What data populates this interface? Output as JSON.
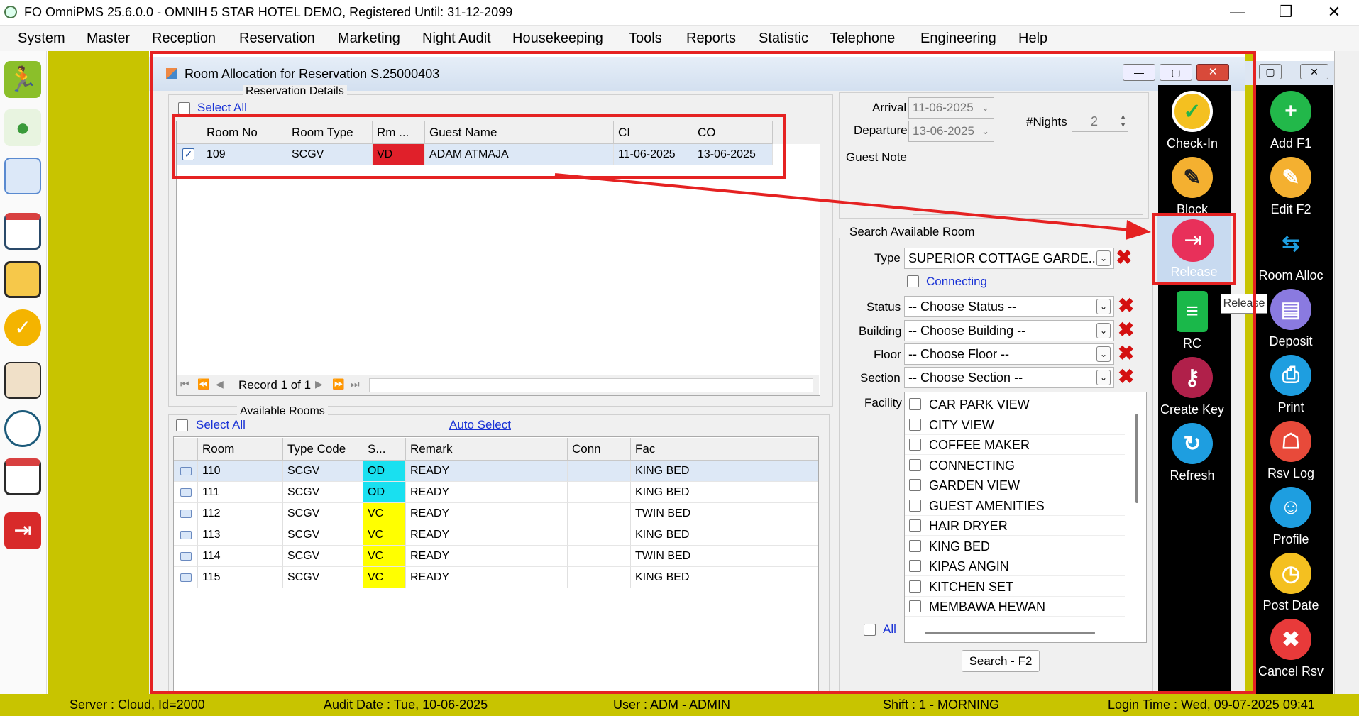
{
  "app": {
    "title": "FO OmniPMS 25.6.0.0 - OMNIH 5 STAR HOTEL DEMO, Registered Until: 31-12-2099"
  },
  "menu": [
    "System",
    "Master",
    "Reception",
    "Reservation",
    "Marketing",
    "Night Audit",
    "Housekeeping",
    "Tools",
    "Reports",
    "Statistic",
    "Telephone",
    "Engineering",
    "Help"
  ],
  "window": {
    "title": "Room Allocation for Reservation S.25000403"
  },
  "reservation": {
    "group_label": "Reservation Details",
    "select_all": "Select All",
    "columns": [
      "Room No",
      "Room Type",
      "Rm ...",
      "Guest Name",
      "CI",
      "CO"
    ],
    "rows": [
      {
        "room_no": "109",
        "room_type": "SCGV",
        "rm": "VD",
        "guest": "ADAM ATMAJA",
        "ci": "11-06-2025",
        "co": "13-06-2025"
      }
    ],
    "record_text": "Record 1 of 1"
  },
  "available": {
    "group_label": "Available Rooms",
    "select_all": "Select All",
    "auto_select": "Auto Select",
    "columns": [
      "Room",
      "Type Code",
      "S...",
      "Remark",
      "Conn",
      "Fac"
    ],
    "rows": [
      {
        "room": "110",
        "type": "SCGV",
        "status": "OD",
        "remark": "READY",
        "conn": "",
        "fac": "KING BED"
      },
      {
        "room": "111",
        "type": "SCGV",
        "status": "OD",
        "remark": "READY",
        "conn": "",
        "fac": "KING BED"
      },
      {
        "room": "112",
        "type": "SCGV",
        "status": "VC",
        "remark": "READY",
        "conn": "",
        "fac": "TWIN BED"
      },
      {
        "room": "113",
        "type": "SCGV",
        "status": "VC",
        "remark": "READY",
        "conn": "",
        "fac": "KING BED"
      },
      {
        "room": "114",
        "type": "SCGV",
        "status": "VC",
        "remark": "READY",
        "conn": "",
        "fac": "TWIN BED"
      },
      {
        "room": "115",
        "type": "SCGV",
        "status": "VC",
        "remark": "READY",
        "conn": "",
        "fac": "KING BED"
      }
    ]
  },
  "dates": {
    "arrival_label": "Arrival",
    "arrival": "11-06-2025",
    "departure_label": "Departure",
    "departure": "13-06-2025",
    "nights_label": "#Nights",
    "nights": "2",
    "guest_note_label": "Guest Note"
  },
  "search": {
    "group_label": "Search Available Room",
    "type_label": "Type",
    "type_value": "SUPERIOR COTTAGE GARDE...",
    "connecting": "Connecting",
    "status_label": "Status",
    "status_value": "-- Choose Status --",
    "building_label": "Building",
    "building_value": "-- Choose Building --",
    "floor_label": "Floor",
    "floor_value": "-- Choose Floor --",
    "section_label": "Section",
    "section_value": "-- Choose Section --",
    "facility_label": "Facility",
    "facilities": [
      "CAR PARK VIEW",
      "CITY VIEW",
      "COFFEE MAKER",
      "CONNECTING",
      "GARDEN VIEW",
      "GUEST AMENITIES",
      "HAIR DRYER",
      "KING BED",
      "KIPAS ANGIN",
      "KITCHEN SET",
      "MEMBAWA HEWAN"
    ],
    "all_label": "All",
    "search_button": "Search - F2"
  },
  "actions_inner": [
    "Check-In",
    "Block",
    "Release",
    "RC",
    "Create Key",
    "Refresh"
  ],
  "tooltip": "Release",
  "actions_outer": [
    "Add F1",
    "Edit F2",
    "Room Alloc",
    "Deposit",
    "Print",
    "Rsv Log",
    "Profile",
    "Post Date",
    "Cancel Rsv"
  ],
  "status_bar": {
    "server": "Server : Cloud, Id=2000",
    "audit": "Audit Date : Tue, 10-06-2025",
    "user": "User : ADM - ADMIN",
    "shift": "Shift : 1 - MORNING",
    "login": "Login Time : Wed, 09-07-2025 09:41"
  },
  "colors": {
    "accent_red": "#e52222",
    "olive": "#c8c400",
    "status_vd": "#e0202a",
    "status_od": "#19e0f0",
    "status_vc": "#ffff00"
  }
}
